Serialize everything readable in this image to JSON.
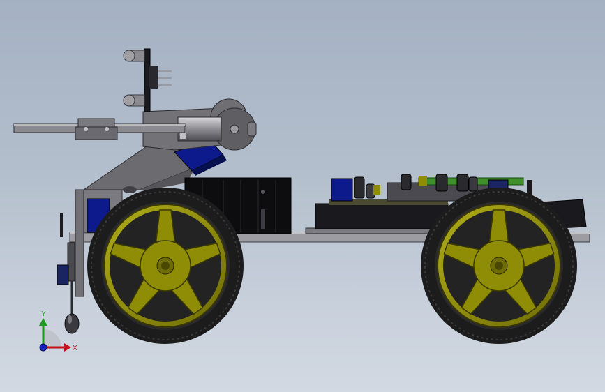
{
  "view": {
    "background_top": "#a4b1c2",
    "background_bottom": "#d2d9e2"
  },
  "model": {
    "parts": [
      "robot-chassis",
      "front-wheel",
      "rear-wheel",
      "robot-arm",
      "gripper",
      "servo-motor",
      "battery-pack",
      "controller-board",
      "ultrasonic-sensor",
      "ir-sensor"
    ],
    "colors": {
      "rim": "#8f8c05",
      "tire": "#1c1c1c",
      "bracket": "#6e6e73",
      "servo": "#0d1a8c",
      "pcb": "#3f8f2a",
      "metal": "#9a9aa0"
    }
  },
  "triad": {
    "x_label": "X",
    "y_label": "Y",
    "x_color": "#c0101a",
    "y_color": "#1e9a20",
    "z_color": "#1620c0"
  }
}
